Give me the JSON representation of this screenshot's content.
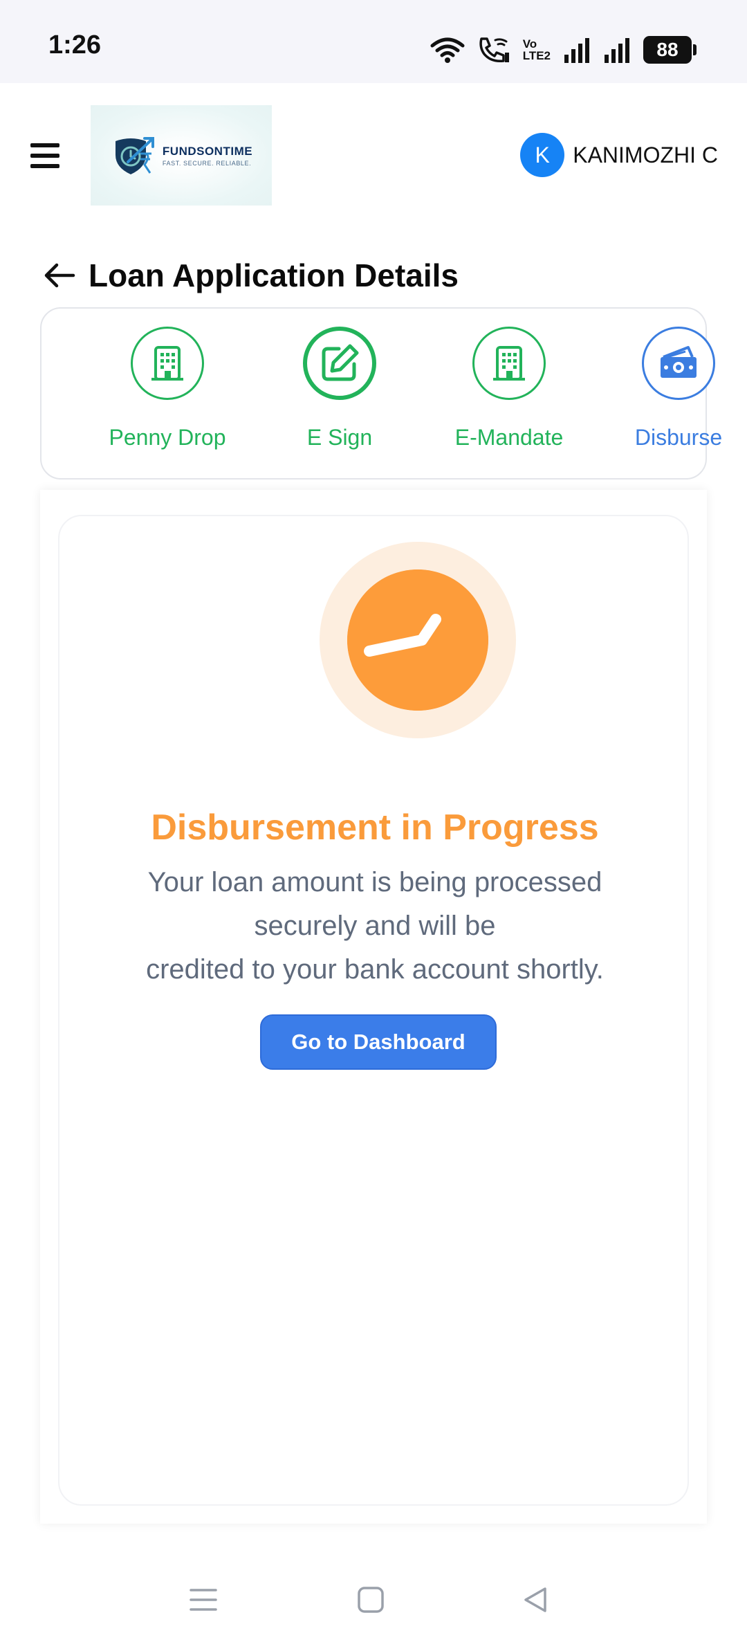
{
  "status_bar": {
    "time": "1:26",
    "battery": "88",
    "volte_top": "Vo",
    "volte_bottom": "LTE2"
  },
  "header": {
    "logo": {
      "brand": "FUNDSONTIME",
      "tagline": "FAST. SECURE. RELIABLE."
    },
    "user": {
      "initial": "K",
      "name": "KANIMOZHI C"
    }
  },
  "page": {
    "title": "Loan Application Details"
  },
  "steps": [
    {
      "label": "Penny Drop",
      "icon": "building-icon",
      "state": "done"
    },
    {
      "label": "E Sign",
      "icon": "edit-icon",
      "state": "done"
    },
    {
      "label": "E-Mandate",
      "icon": "building-icon",
      "state": "done"
    },
    {
      "label": "Disburse",
      "icon": "money-icon",
      "state": "current"
    }
  ],
  "status_card": {
    "icon": "clock-icon",
    "title": "Disbursement in Progress",
    "description_lines": [
      "Your loan amount is being processed",
      "securely and will be",
      "credited to your bank account shortly."
    ],
    "button_label": "Go to Dashboard"
  },
  "colors": {
    "success": "#22b35a",
    "primary": "#3b7de9",
    "warning": "#fd9c3a",
    "avatar": "#1683f5"
  }
}
